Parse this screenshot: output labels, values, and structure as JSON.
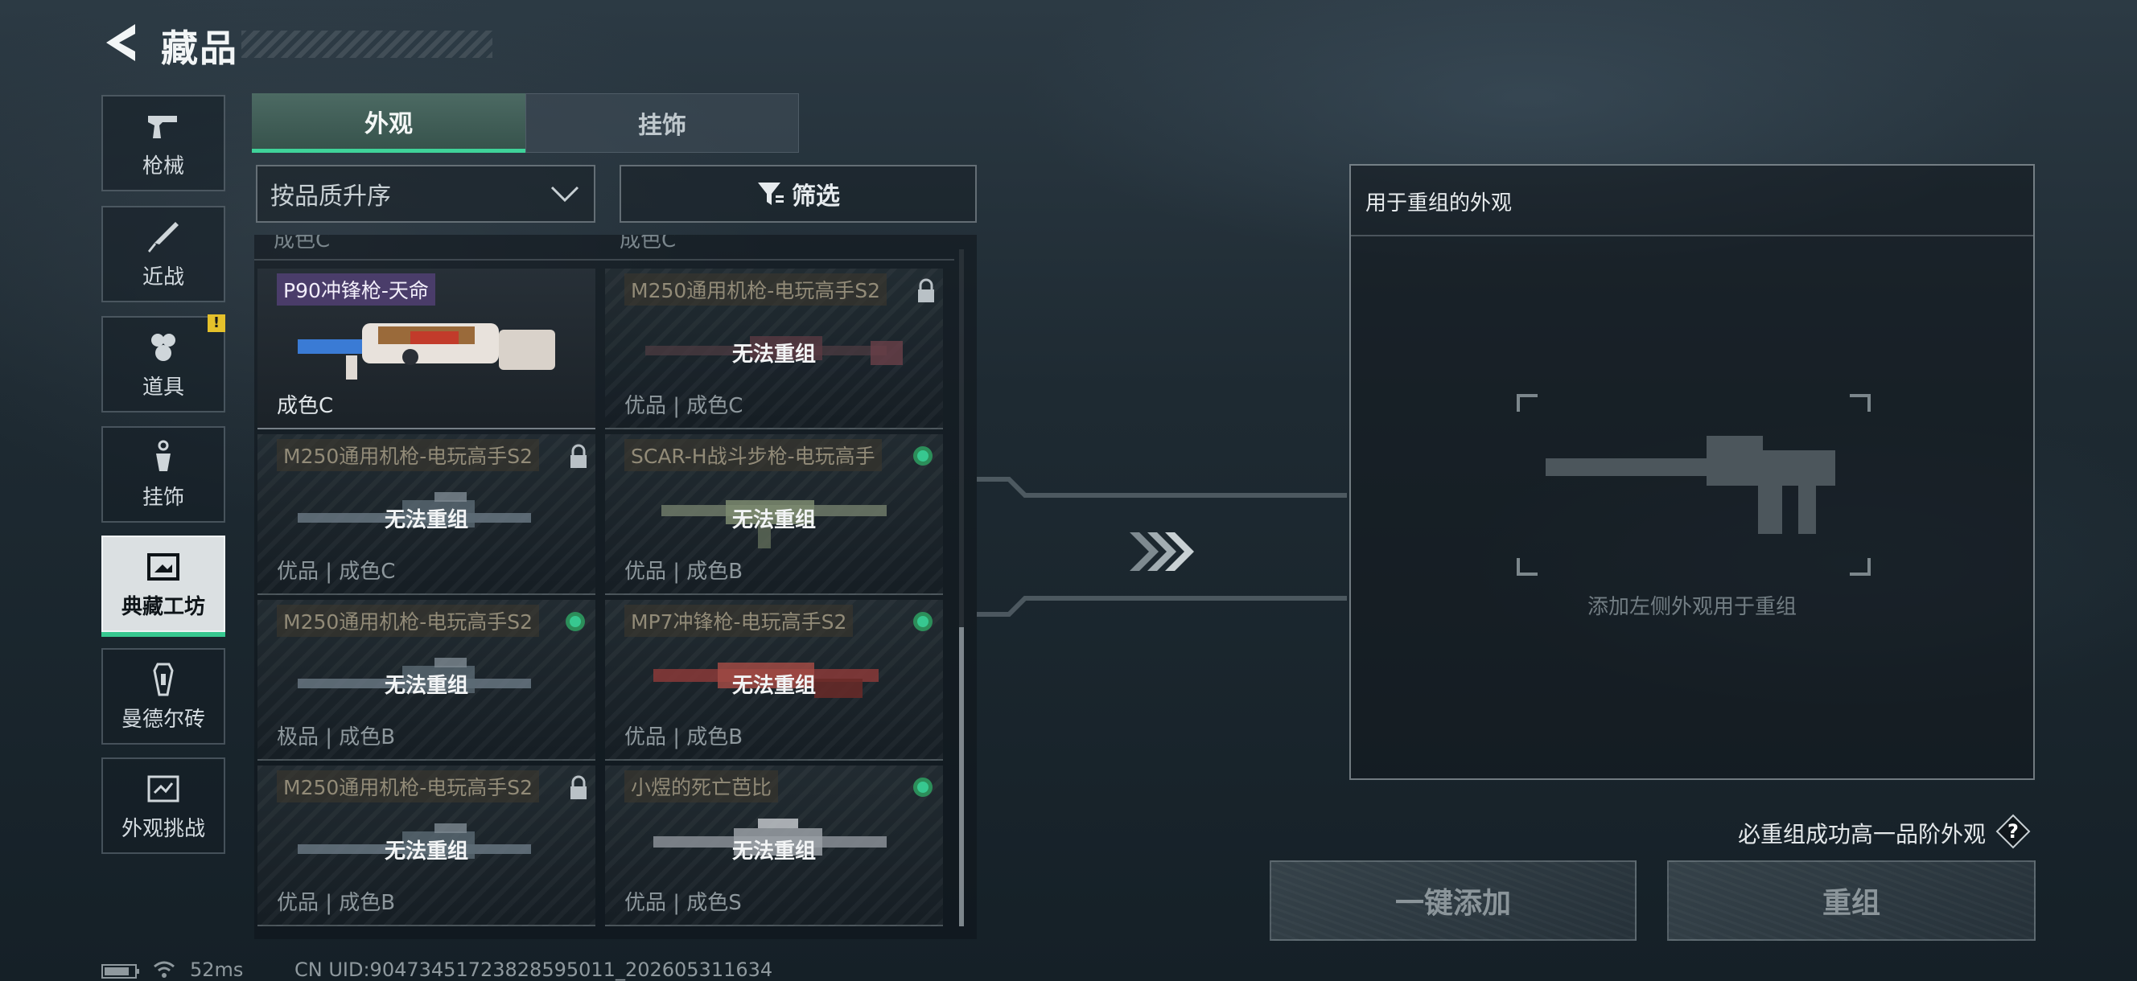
{
  "header": {
    "title": "藏品"
  },
  "sidebar": {
    "items": [
      {
        "label": "枪械",
        "icon": "pistol-icon"
      },
      {
        "label": "近战",
        "icon": "knife-icon"
      },
      {
        "label": "道具",
        "icon": "grenades-icon",
        "badge": "!"
      },
      {
        "label": "挂饰",
        "icon": "charm-icon"
      },
      {
        "label": "典藏工坊",
        "icon": "workshop-icon",
        "active": true
      },
      {
        "label": "曼德尔砖",
        "icon": "mandel-brick-icon"
      },
      {
        "label": "外观挑战",
        "icon": "challenge-icon"
      }
    ]
  },
  "tabs": [
    {
      "label": "外观",
      "active": true
    },
    {
      "label": "挂饰",
      "active": false
    }
  ],
  "sort": {
    "label": "按品质升序"
  },
  "filter": {
    "label": "筛选"
  },
  "grid": {
    "peek": [
      "成色C",
      "成色C"
    ],
    "overlay_text": "无法重组",
    "cards": [
      {
        "name": "P90冲锋枪-天命",
        "quality": "成色C",
        "status": "none",
        "featured": true
      },
      {
        "name": "M250通用机枪-电玩高手S2",
        "quality": "优品 | 成色C",
        "status": "locked"
      },
      {
        "name": "M250通用机枪-电玩高手S2",
        "quality": "优品 | 成色C",
        "status": "locked"
      },
      {
        "name": "SCAR-H战斗步枪-电玩高手",
        "quality": "优品 | 成色B",
        "status": "ok"
      },
      {
        "name": "M250通用机枪-电玩高手S2",
        "quality": "极品 | 成色B",
        "status": "ok"
      },
      {
        "name": "MP7冲锋枪-电玩高手S2",
        "quality": "优品 | 成色B",
        "status": "ok"
      },
      {
        "name": "M250通用机枪-电玩高手S2",
        "quality": "优品 | 成色B",
        "status": "locked"
      },
      {
        "name": "小煜的死亡芭比",
        "quality": "优品 | 成色S",
        "status": "ok"
      }
    ]
  },
  "recombine": {
    "title": "用于重组的外观",
    "hint": "添加左侧外观用于重组",
    "note": "必重组成功高一品阶外观",
    "help_icon": "?",
    "add_button": "一键添加",
    "recombine_button": "重组"
  },
  "status_bar": {
    "ping": "52ms",
    "uid": "CN UID:90473451723828595011_202605311634"
  },
  "colors": {
    "accent_green": "#37c890",
    "lock_gray": "#b9c1c6",
    "featured_tag": "#7850aa"
  }
}
